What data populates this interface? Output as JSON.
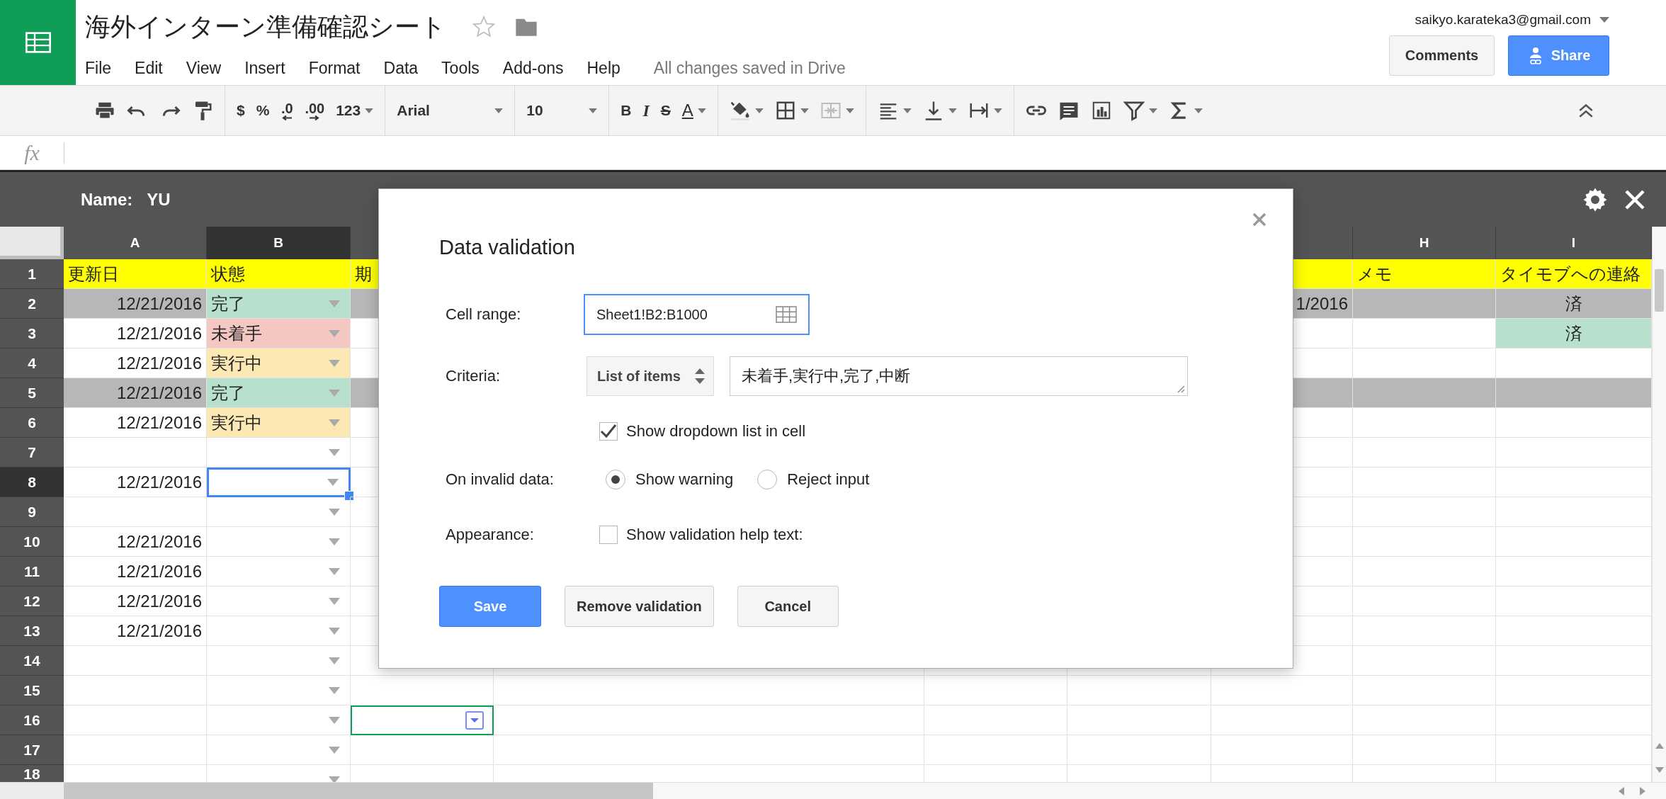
{
  "app": {
    "title": "海外インターン準備確認シート",
    "menu": [
      "File",
      "Edit",
      "View",
      "Insert",
      "Format",
      "Data",
      "Tools",
      "Add-ons",
      "Help"
    ],
    "save_status": "All changes saved in Drive",
    "account": "saikyo.karateka3@gmail.com",
    "buttons": [
      {
        "label": "Comments",
        "kind": "plain"
      },
      {
        "label": "Share",
        "kind": "primary"
      }
    ]
  },
  "toolbar": {
    "currency": "$",
    "percent": "%",
    "decimals_less": ".0",
    "decimals_more": ".00",
    "number_formats": "123",
    "font": "Arial",
    "font_size": "10",
    "bold": "B",
    "italic": "I",
    "strikethrough": "S",
    "text_color": "A"
  },
  "formula_bar": {
    "label": "fx"
  },
  "sheet": {
    "name_label": "Name:",
    "name_value": "YU",
    "columns": [
      {
        "label": "A",
        "selected": false,
        "dropdown": false
      },
      {
        "label": "B",
        "selected": true,
        "dropdown": true
      },
      {
        "selected": false,
        "dropdown": false
      },
      {
        "selected": false,
        "dropdown": false
      },
      {
        "label": "H",
        "selected": false,
        "dropdown": false
      },
      {
        "label": "I",
        "selected": false,
        "dropdown": false
      }
    ],
    "rows": [
      {
        "number": "1",
        "kind": "header",
        "selected": false,
        "shaded": false,
        "cells": [
          {
            "text": "更新日",
            "kind": "text",
            "selected": false
          },
          {
            "text": "状態",
            "kind": "text",
            "selected": false
          },
          {
            "text": "期",
            "kind": "text",
            "selected": false
          },
          {
            "selected": false
          },
          {
            "text": "メモ",
            "kind": "text",
            "selected": false
          },
          {
            "text": "タイモブへの連絡",
            "kind": "text",
            "selected": false
          }
        ]
      },
      {
        "number": "2",
        "kind": "data",
        "selected": false,
        "shaded": true,
        "cells": [
          {
            "text": "12/21/2016",
            "kind": "number",
            "selected": false
          },
          {
            "text": "完了",
            "kind": "text",
            "color": "#b7e1cd",
            "selected": false
          },
          {
            "selected": false
          },
          {
            "text": "1/2016",
            "kind": "number",
            "selected": false
          },
          {
            "selected": false
          },
          {
            "text": "済",
            "kind": "centered",
            "selected": false
          }
        ]
      },
      {
        "number": "3",
        "kind": "data",
        "selected": false,
        "shaded": false,
        "cells": [
          {
            "text": "12/21/2016",
            "kind": "number",
            "selected": false
          },
          {
            "text": "未着手",
            "kind": "text",
            "color": "#f4c7c3",
            "selected": false
          },
          {
            "selected": false
          },
          {
            "selected": false
          },
          {
            "selected": false
          },
          {
            "text": "済",
            "kind": "centered",
            "color": "#b7e1cd",
            "selected": false
          }
        ]
      },
      {
        "number": "4",
        "kind": "data",
        "selected": false,
        "shaded": false,
        "cells": [
          {
            "text": "12/21/2016",
            "kind": "number",
            "selected": false
          },
          {
            "text": "実行中",
            "kind": "text",
            "color": "#fce8b2",
            "selected": false
          },
          {
            "selected": false
          },
          {
            "selected": false
          },
          {
            "selected": false
          },
          {
            "selected": false
          }
        ]
      },
      {
        "number": "5",
        "kind": "data",
        "selected": false,
        "shaded": true,
        "cells": [
          {
            "text": "12/21/2016",
            "kind": "number",
            "selected": false
          },
          {
            "text": "完了",
            "kind": "text",
            "color": "#b7e1cd",
            "selected": false
          },
          {
            "selected": false
          },
          {
            "selected": false
          },
          {
            "selected": false
          },
          {
            "selected": false
          }
        ]
      },
      {
        "number": "6",
        "kind": "data",
        "selected": false,
        "shaded": false,
        "cells": [
          {
            "text": "12/21/2016",
            "kind": "number",
            "selected": false
          },
          {
            "text": "実行中",
            "kind": "text",
            "color": "#fce8b2",
            "selected": false
          },
          {
            "selected": false
          },
          {
            "selected": false
          },
          {
            "selected": false
          },
          {
            "selected": false
          }
        ]
      },
      {
        "number": "7",
        "kind": "data",
        "selected": false,
        "shaded": false,
        "cells": [
          {
            "selected": false
          },
          {
            "selected": false
          },
          {
            "selected": false
          },
          {
            "selected": false
          },
          {
            "selected": false
          },
          {
            "selected": false
          }
        ]
      },
      {
        "number": "8",
        "kind": "data",
        "selected": true,
        "shaded": false,
        "cells": [
          {
            "text": "12/21/2016",
            "kind": "number",
            "selected": false
          },
          {
            "selected": true
          },
          {
            "selected": false
          },
          {
            "selected": false
          },
          {
            "selected": false
          },
          {
            "selected": false
          }
        ]
      },
      {
        "number": "9",
        "kind": "data",
        "selected": false,
        "shaded": false,
        "cells": [
          {
            "selected": false
          },
          {
            "selected": false
          },
          {
            "selected": false
          },
          {
            "selected": false
          },
          {
            "selected": false
          },
          {
            "selected": false
          }
        ]
      },
      {
        "number": "10",
        "kind": "data",
        "selected": false,
        "shaded": false,
        "cells": [
          {
            "text": "12/21/2016",
            "kind": "number",
            "selected": false
          },
          {
            "selected": false
          },
          {
            "selected": false
          },
          {
            "selected": false
          },
          {
            "selected": false
          },
          {
            "selected": false
          }
        ]
      },
      {
        "number": "11",
        "kind": "data",
        "selected": false,
        "shaded": false,
        "cells": [
          {
            "text": "12/21/2016",
            "kind": "number",
            "selected": false
          },
          {
            "selected": false
          },
          {
            "selected": false
          },
          {
            "selected": false
          },
          {
            "selected": false
          },
          {
            "selected": false
          }
        ]
      },
      {
        "number": "12",
        "kind": "data",
        "selected": false,
        "shaded": false,
        "cells": [
          {
            "text": "12/21/2016",
            "kind": "number",
            "selected": false
          },
          {
            "selected": false
          },
          {
            "selected": false
          },
          {
            "selected": false
          },
          {
            "selected": false
          },
          {
            "selected": false
          }
        ]
      },
      {
        "number": "13",
        "kind": "data",
        "selected": false,
        "shaded": false,
        "cells": [
          {
            "text": "12/21/2016",
            "kind": "number",
            "selected": false
          },
          {
            "selected": false
          },
          {
            "selected": false
          },
          {
            "selected": false
          },
          {
            "selected": false
          },
          {
            "selected": false
          }
        ]
      },
      {
        "number": "14",
        "kind": "data",
        "selected": false,
        "shaded": false,
        "cells": [
          {
            "selected": false
          },
          {
            "selected": false
          },
          {
            "selected": false
          },
          {
            "selected": false
          },
          {
            "selected": false
          },
          {
            "selected": false
          },
          {
            "selected": false
          },
          {
            "selected": false
          },
          {
            "selected": false
          }
        ]
      },
      {
        "number": "15",
        "kind": "data",
        "selected": false,
        "shaded": false,
        "cells": [
          {
            "selected": false
          },
          {
            "selected": false
          },
          {
            "selected": false
          },
          {
            "selected": false
          },
          {
            "selected": false
          },
          {
            "selected": false
          },
          {
            "selected": false
          },
          {
            "selected": false
          },
          {
            "selected": false
          }
        ]
      },
      {
        "number": "16",
        "kind": "data",
        "selected": false,
        "shaded": false,
        "cells": [
          {
            "selected": false
          },
          {
            "selected": false
          },
          {
            "kind": "chip",
            "selected": false
          },
          {
            "selected": false
          },
          {
            "selected": false
          },
          {
            "selected": false
          },
          {
            "selected": false
          },
          {
            "selected": false
          },
          {
            "selected": false
          }
        ]
      },
      {
        "number": "17",
        "kind": "data",
        "selected": false,
        "shaded": false,
        "cells": [
          {
            "selected": false
          },
          {
            "selected": false
          },
          {
            "selected": false
          },
          {
            "selected": false
          },
          {
            "selected": false
          },
          {
            "selected": false
          },
          {
            "selected": false
          },
          {
            "selected": false
          },
          {
            "selected": false
          }
        ]
      },
      {
        "number": "18",
        "kind": "data",
        "selected": false,
        "shaded": false,
        "cells": [
          {
            "selected": false
          },
          {
            "selected": false
          },
          {
            "selected": false
          },
          {
            "selected": false
          },
          {
            "selected": false
          },
          {
            "selected": false
          },
          {
            "selected": false
          },
          {
            "selected": false
          },
          {
            "selected": false
          }
        ]
      }
    ]
  },
  "dialog": {
    "title": "Data validation",
    "cell_range": {
      "label": "Cell range:",
      "value": "Sheet1!B2:B1000"
    },
    "criteria": {
      "label": "Criteria:",
      "type": "List of items",
      "value": "未着手,実行中,完了,中断"
    },
    "show_dropdown": {
      "label": "Show dropdown list in cell",
      "checked": true
    },
    "invalid_data": {
      "label": "On invalid data:",
      "options": [
        {
          "label": "Show warning",
          "selected": true
        },
        {
          "label": "Reject input",
          "selected": false
        }
      ]
    },
    "appearance": {
      "label": "Appearance:",
      "help_text": {
        "label": "Show validation help text:",
        "checked": false
      }
    },
    "buttons": [
      {
        "label": "Save",
        "kind": "primary"
      },
      {
        "label": "Remove validation",
        "kind": "secondary"
      },
      {
        "label": "Cancel",
        "kind": "secondary"
      }
    ]
  }
}
